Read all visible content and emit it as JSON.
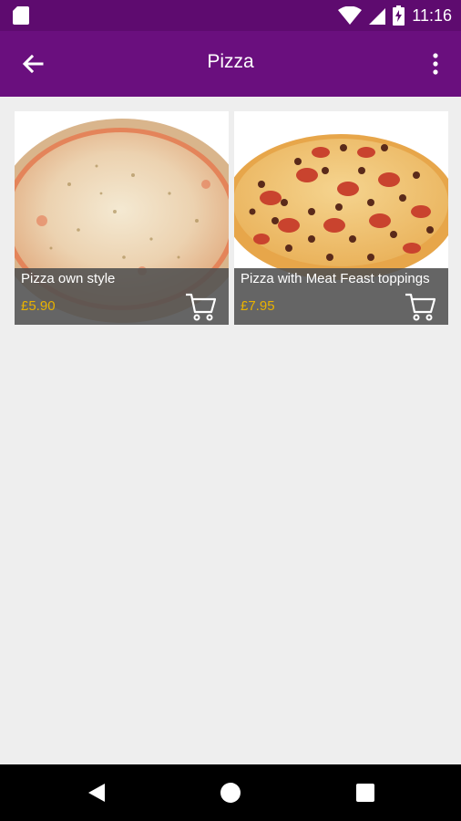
{
  "status_bar": {
    "time": "11:16",
    "icons": [
      "sd-card-icon",
      "wifi-icon",
      "cellular-signal-icon",
      "battery-charging-icon"
    ]
  },
  "app_bar": {
    "title": "Pizza",
    "back_icon": "arrow-back-icon",
    "menu_icon": "more-vert-icon"
  },
  "products": [
    {
      "name": "Pizza own style",
      "price": "£5.90",
      "image": "margherita-pizza",
      "cart_icon": "cart-icon"
    },
    {
      "name": "Pizza with Meat Feast toppings",
      "price": "£7.95",
      "image": "meat-feast-pizza",
      "cart_icon": "cart-icon"
    }
  ],
  "nav_bar": {
    "icons": [
      "nav-back-icon",
      "nav-home-icon",
      "nav-recents-icon"
    ]
  },
  "colors": {
    "status_bar": "#5e0b6f",
    "app_bar": "#6a0f7e",
    "background": "#eeeeee",
    "price": "#e9b200"
  }
}
